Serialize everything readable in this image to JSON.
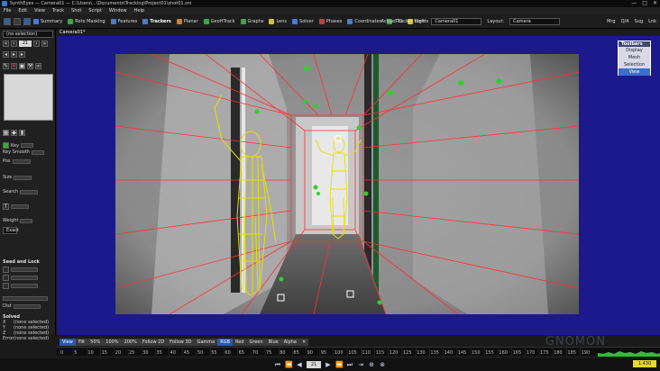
{
  "window": {
    "title": "SynthEyes — Camera01 — C:\\Users\\...\\Documents\\Tracking\\Project01\\shot01.sni",
    "controls": [
      "—",
      "□",
      "✕"
    ]
  },
  "menu": [
    "File",
    "Edit",
    "View",
    "Track",
    "Shot",
    "Script",
    "Window",
    "Help"
  ],
  "rooms": [
    {
      "label": "Summary",
      "color": "blue"
    },
    {
      "label": "Roto Masking",
      "color": "green"
    },
    {
      "label": "Features",
      "color": "blue"
    },
    {
      "label": "Trackers",
      "color": "blue",
      "active": true
    },
    {
      "label": "Planar",
      "color": "orange"
    },
    {
      "label": "GeoHTrack",
      "color": "green"
    },
    {
      "label": "Graphs",
      "color": "green"
    },
    {
      "label": "Lens",
      "color": "yellow"
    },
    {
      "label": "Solver",
      "color": "blue"
    },
    {
      "label": "Phases",
      "color": "red"
    },
    {
      "label": "Coordinates",
      "color": "blue"
    },
    {
      "label": "3-D",
      "color": "green"
    },
    {
      "label": "Lights",
      "color": "yellow"
    }
  ],
  "toolbar_right": {
    "active_tracker_host_label": "Active Tracker Host:",
    "active_tracker_host_value": "Camera01",
    "layout_label": "Layout:",
    "layout_value": "Camera",
    "mini_buttons": [
      "Mrg",
      "Q/A",
      "Sug",
      "Lnk"
    ]
  },
  "left_panel": {
    "selection_dropdown": "(no selection)",
    "frame_value": "21",
    "key_label": "Key",
    "key_smooth_label": "Key Smooth",
    "pos_label": "Pos",
    "size_label": "Size",
    "search_label": "Search",
    "weight_label": "Weight",
    "exact_label": "Exact",
    "seed_lock_header": "Seed and Lock",
    "solved_header": "Solved",
    "solved_rows": [
      {
        "axis": "X",
        "value": "(none selected)"
      },
      {
        "axis": "Y",
        "value": "(none selected)"
      },
      {
        "axis": "Z",
        "value": "(none selected)"
      },
      {
        "axis": "Error",
        "value": "(none selected)"
      }
    ],
    "dist_label": "Dist"
  },
  "viewport": {
    "camera_tab": "Camera01*",
    "toolbars_panel": {
      "header": "Toolbars",
      "items": [
        "Display",
        "Mesh",
        "Selection",
        "View"
      ],
      "selected": "View"
    }
  },
  "view_tabs": {
    "items": [
      "View",
      "Filt",
      "50%",
      "100%",
      "200%",
      "Follow 2D",
      "Follow 3D",
      "Gamma",
      "RGB",
      "Red",
      "Green",
      "Blue",
      "Alpha"
    ],
    "selected": [
      "View",
      "RGB"
    ]
  },
  "timeline": {
    "frame_labels": [
      "0",
      "5",
      "10",
      "15",
      "20",
      "25",
      "30",
      "35",
      "40",
      "45",
      "50",
      "55",
      "60",
      "65",
      "70",
      "75",
      "80",
      "85",
      "90",
      "95",
      "100",
      "105",
      "110",
      "115",
      "120",
      "125",
      "130",
      "135",
      "140",
      "145",
      "150",
      "155",
      "160",
      "165",
      "170",
      "175",
      "180",
      "185",
      "190"
    ],
    "current_frame": "21"
  },
  "transport": {
    "buttons": [
      "⏮",
      "⏪",
      "◀",
      "▶",
      "⏩",
      "⏭"
    ],
    "frame": "21"
  },
  "hpix_badge": "1.430 HPIX",
  "watermark": "GNOMON",
  "colors": {
    "viewport_bg": "#1b198b",
    "selection_blue": "#2b56b0",
    "mesh_yellow": "#e8e000",
    "tracker_green": "#2fd02f",
    "grid_red": "#ff3030"
  }
}
